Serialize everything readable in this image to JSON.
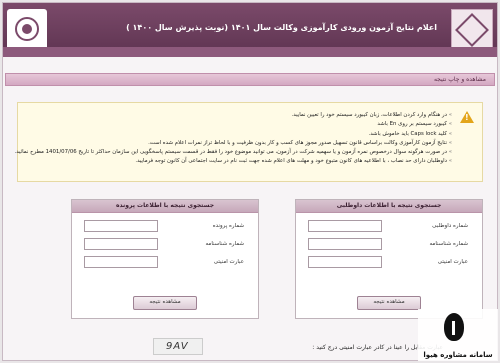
{
  "header": {
    "title": "اعلام نتایج آزمون ورودی کارآموزی وکالت سال ۱۴۰۱ (نوبت پذیرش سال ۱۴۰۰ )",
    "subtitle": ""
  },
  "navbar": {
    "label": "مشاهده و چاپ نتیجه"
  },
  "notice": {
    "items": [
      "در هنگام وارد کردن اطلاعات، زبان کیبورد سیستم خود را تعیین نمایید.",
      "کیبورد سیستم بر روی En باشد",
      "کلید Caps lock باید خاموش باشد.",
      "نتایج آزمون کارآموزی وکالت براساس قانون تسهیل صدور مجوز های کسب و کار بدون ظرفیت و با لحاظ تراز نمرات اعلام شده است.",
      "در صورت هرگونه سوال درخصوص نمره آزمون و یا سهمیه شرکت در آزمون، می توانید موضوع خود را فقط در قسمت سیستم پاسخگویی این سازمان حداکثر تا تاریخ 1401/07/06 مطرح نمائید.",
      "داوطلبان دارای حد نصاب ، با اطلاعیه های کانون متبوع خود و مهلت های اعلام شده جهت ثبت نام در سایت اجتماعی آن کانون توجه فرمایید."
    ]
  },
  "panel_left": {
    "title": "جستجوی نتیجه با اطلاعات پرونده",
    "fields": [
      "شماره پرونده",
      "شماره شناسنامه",
      "عبارت امنیتی"
    ],
    "button": "مشاهده نتیجه"
  },
  "panel_right": {
    "title": "جستجوی نتیجه با اطلاعات داوطلبی",
    "fields": [
      "شماره داوطلبی",
      "شماره شناسنامه",
      "عبارت امنیتی"
    ],
    "button": "مشاهده نتیجه"
  },
  "captcha": {
    "label": "عبارت مقابل را عینا در کادر عبارت امنیتی درج کنید :",
    "code": "9AV"
  },
  "watermark": {
    "text": "سامانه مشاوره هیوا"
  }
}
